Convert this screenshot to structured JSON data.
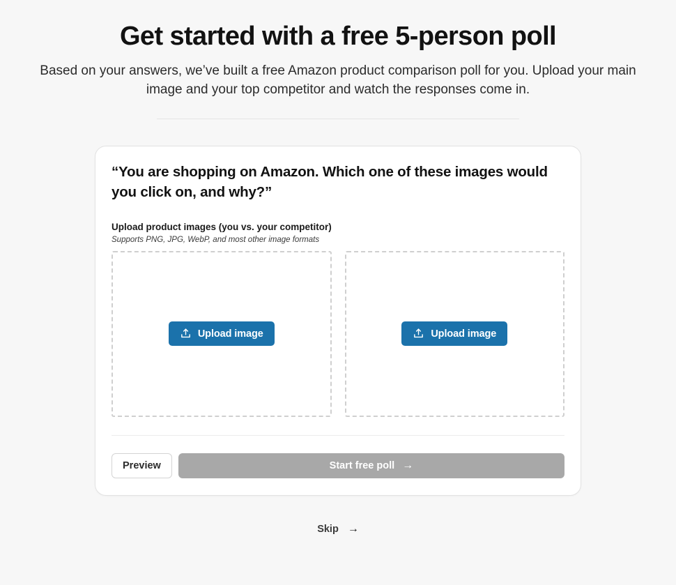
{
  "page": {
    "background_color": "#f7f7f7",
    "title": "Get started with a free 5-person poll",
    "subtitle": "Based on your answers, we’ve built a free Amazon product comparison poll for you. Upload your main image and your top competitor and watch the responses come in."
  },
  "card": {
    "question": "“You are shopping on Amazon. Which one of these images would you click on, and why?”",
    "upload_section": {
      "label": "Upload product images (you vs. your competitor)",
      "hint": "Supports PNG, JPG, WebP, and most other image formats",
      "dropzones": [
        {
          "name": "your-product",
          "button_label": "Upload image",
          "button_icon": "upload-icon"
        },
        {
          "name": "competitor-product",
          "button_label": "Upload image",
          "button_icon": "upload-icon"
        }
      ]
    },
    "actions": {
      "preview_label": "Preview",
      "start_label": "Start free poll",
      "start_icon": "arrow-right-icon",
      "start_color": "#a8a8a8",
      "accent_color": "#1b72ab"
    }
  },
  "footer": {
    "skip_label": "Skip",
    "skip_icon": "arrow-right-icon"
  }
}
